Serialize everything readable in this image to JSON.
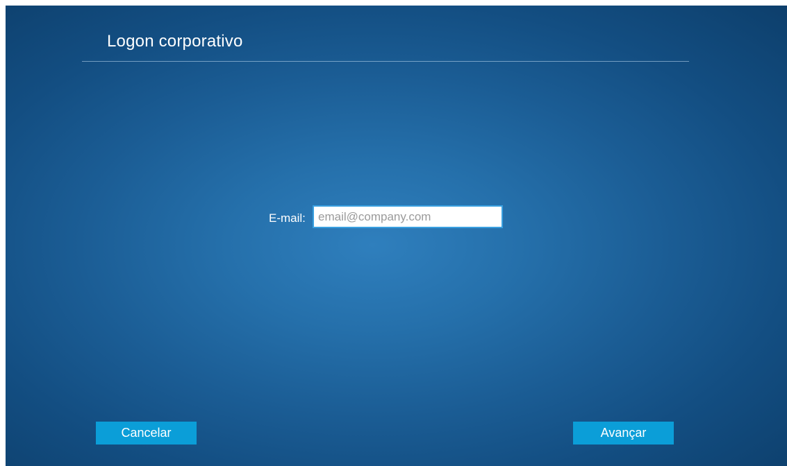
{
  "page": {
    "title": "Logon corporativo"
  },
  "form": {
    "email_label": "E-mail:",
    "email_value": "",
    "email_placeholder": "email@company.com"
  },
  "buttons": {
    "cancel_label": "Cancelar",
    "next_label": "Avançar"
  },
  "colors": {
    "background_center": "#2f7fbd",
    "background_edge": "#0d3f6c",
    "button": "#0b9ed8",
    "input_border": "#3aa0e0",
    "text": "#ffffff"
  }
}
